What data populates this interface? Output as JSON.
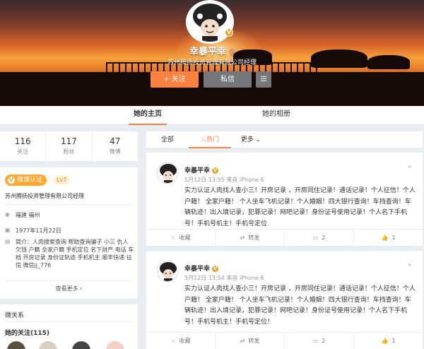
{
  "profile": {
    "nickname": "幸暴平幸",
    "company": "苏州腾扬投资管理有限公司经理",
    "follow_btn": "+ 关注",
    "message_btn": "私信"
  },
  "tabs": {
    "home": "她的主页",
    "album": "她的相册"
  },
  "stats": [
    {
      "value": "116",
      "label": "关注"
    },
    {
      "value": "117",
      "label": "粉丝"
    },
    {
      "value": "47",
      "label": "微博"
    }
  ],
  "info": {
    "verify_tag": "微博认证",
    "level": "Lv7",
    "verify_text": "苏州腾扬投资管理有限公司经理",
    "location": "福建 福州",
    "birthday": "1977年11月22日",
    "intro": "简介：人肉搜索查询 帮助查询骗子 小三 仇人 欠钱 户籍 全家户籍 手机定位 名下财产 电话 车档 开房记录 身份证轨迹 手机机主 顺丰快递 征信 微信jj_776",
    "see_more": "查看更多 ›"
  },
  "relations": {
    "title": "微关系",
    "following": "她的关注(115)"
  },
  "filter": {
    "all": "全部",
    "hot": "热门",
    "more": "更多"
  },
  "posts": [
    {
      "name": "幸暴平幸",
      "time": "5月12日 13:55 来自 iPhone 6",
      "text": "实力认证人肉找人查小三！开房记录 ，开房同住记录！通话记录！个人征信！个人户籍！ 全家户籍！ 个人坐车飞机记录！个人婚姻！四大银行查询！车挡查询！车辆轨迹！出入境记录，犯罪记录！网吧记录！身份证号使用记录！个人名下手机号！手机号机主！手机号定位",
      "collect": "收藏",
      "repost": "转发",
      "comments": "2",
      "likes": "1"
    },
    {
      "name": "幸暴平幸",
      "time": "5月12日 13:54 来自 iPhone 6",
      "text": "实力认证人肉找人查小三！开房记录 ，开房同住记录！通话记录！个人征信！个人户籍！ 全家户籍！ 个人坐车飞机记录！个人婚姻！四大银行查询！车挡查询！车辆轨迹！出入境记录，犯罪记录！网吧记录！身份证号使用记录！个人名下手机号！手机号机主！手机号定位！",
      "collect": "收藏",
      "repost": "转发",
      "comments": "2",
      "likes": "1"
    }
  ]
}
